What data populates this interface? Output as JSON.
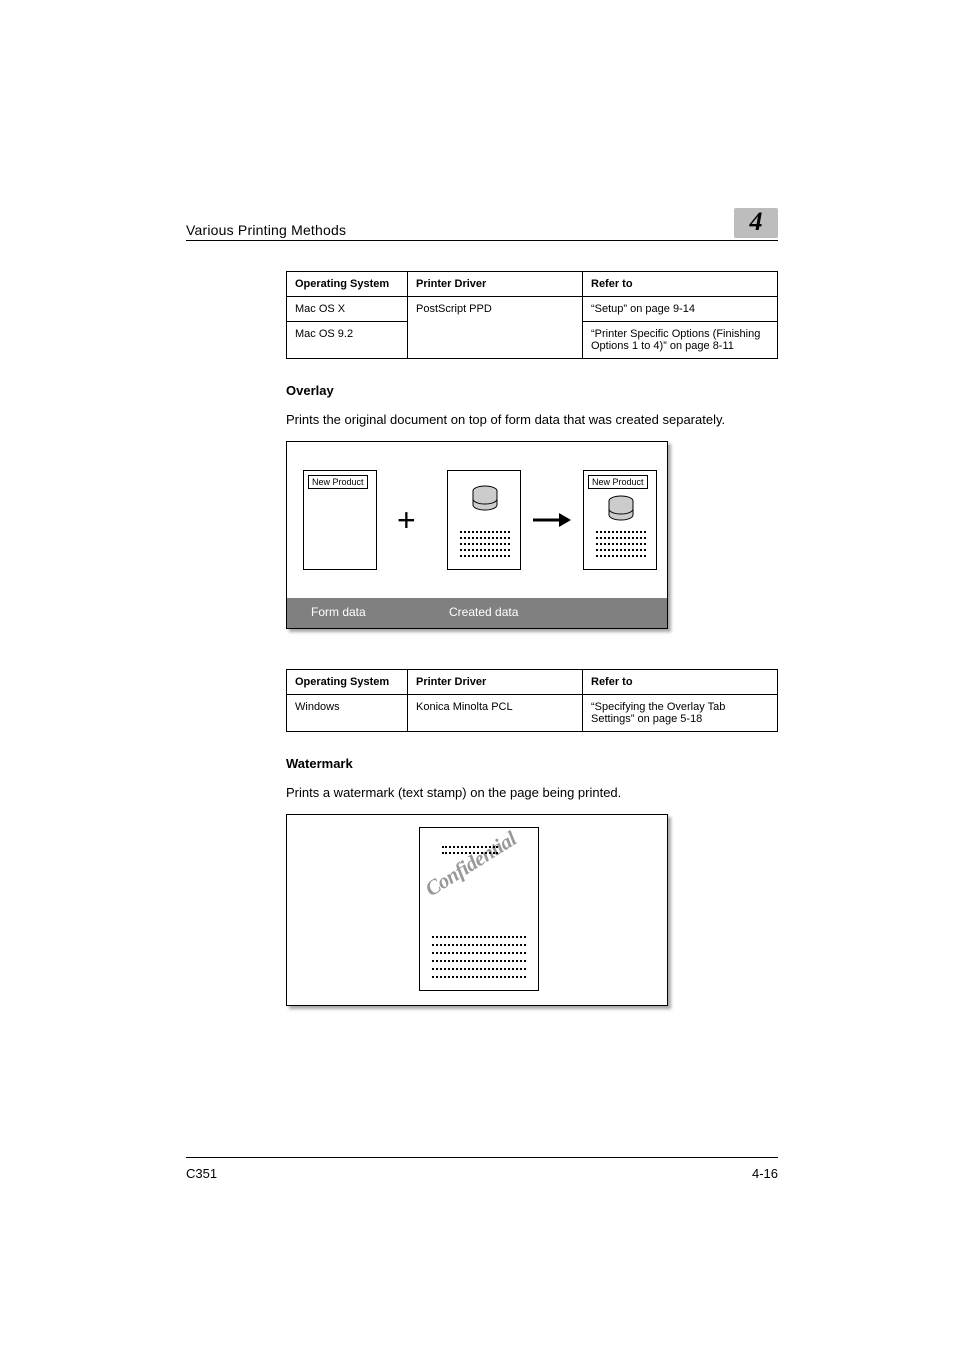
{
  "header": {
    "title": "Various Printing Methods",
    "chapter": "4"
  },
  "table1": {
    "headers": {
      "os": "Operating System",
      "driver": "Printer Driver",
      "refer": "Refer to"
    },
    "rows": [
      {
        "os": "Mac OS X",
        "driver": "PostScript PPD",
        "refer": "“Setup” on page 9-14"
      },
      {
        "os": "Mac OS 9.2",
        "driver": "",
        "refer": "“Printer Specific Options (Finishing Options 1 to 4)” on page 8-11"
      }
    ]
  },
  "overlay": {
    "heading": "Overlay",
    "desc": "Prints the original document on top of form data that was created separately.",
    "diagram": {
      "new_product": "New Product",
      "form_caption": "Form data",
      "created_caption": "Created data"
    }
  },
  "table2": {
    "headers": {
      "os": "Operating System",
      "driver": "Printer Driver",
      "refer": "Refer to"
    },
    "rows": [
      {
        "os": "Windows",
        "driver": "Konica Minolta PCL",
        "refer": "“Specifying the Overlay Tab Settings” on page 5-18"
      }
    ]
  },
  "watermark": {
    "heading": "Watermark",
    "desc": "Prints a watermark (text stamp) on the page being printed.",
    "word": "Confidential"
  },
  "footer": {
    "left": "C351",
    "right": "4-16"
  }
}
